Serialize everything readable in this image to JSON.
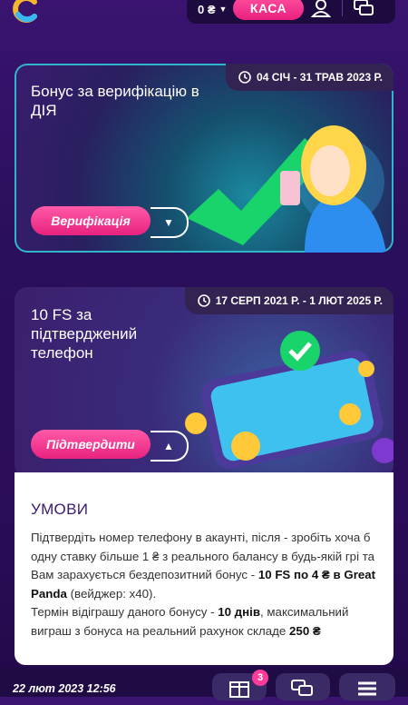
{
  "header": {
    "balance": "0 ₴",
    "kasa_label": "КАСА"
  },
  "cards": [
    {
      "title": "Бонус за верифікацію в ДІЯ",
      "date_range": "04 СІЧ - 31 ТРАВ 2023 Р.",
      "button_label": "Верифікація"
    },
    {
      "title": "10 FS за підтверджений телефон",
      "date_range": "17 СЕРП 2021 Р. - 1 ЛЮТ 2025 Р.",
      "button_label": "Підтвердити"
    }
  ],
  "conditions": {
    "heading": "УМОВИ",
    "p1_a": "Підтвердіть номер телефону в акаунті, після - зробіть хоча б одну ставку більше 1 ₴ з реального балансу в будь-якій грі та Вам зарахується бездепозитний бонус - ",
    "p1_b": "10 FS по 4 ₴ в Great Panda",
    "p1_c": " (вейджер: x40).",
    "p2_a": "Термін відіграшу даного бонусу - ",
    "p2_b": "10 днів",
    "p2_c": ", максимальний виграш з бонуса на реальний рахунок складе ",
    "p2_d": "250 ₴"
  },
  "footer": {
    "datetime": "22 лют 2023 12:56",
    "gift_badge": "3"
  },
  "icons": [
    "logo-icon",
    "chevron-down-icon",
    "user-icon",
    "chat-icon",
    "clock-icon",
    "gift-icon",
    "menu-icon"
  ]
}
